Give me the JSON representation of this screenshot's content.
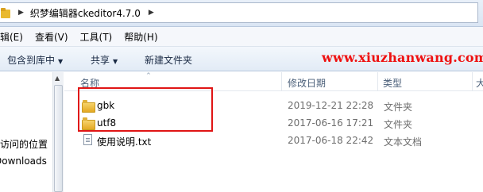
{
  "address": {
    "crumb": "织梦编辑器ckeditor4.7.0",
    "sep_glyph": "▶"
  },
  "menu": {
    "items": [
      "编辑(E)",
      "查看(V)",
      "工具(T)",
      "帮助(H)"
    ]
  },
  "toolbar": {
    "include_library": "包含到库中",
    "share": "共享",
    "new_folder": "新建文件夹",
    "dropdown_glyph": "▼"
  },
  "watermark": "www.xiuzhanwang.com",
  "nav": {
    "items": [
      "访问的位置",
      "Downloads"
    ],
    "scroll_up_glyph": "▲"
  },
  "columns": {
    "name": "名称",
    "date": "修改日期",
    "type": "类型",
    "size": "大",
    "sort_glyph": "^"
  },
  "files": [
    {
      "name": "gbk",
      "date": "2019-12-21 22:28",
      "type": "文件夹",
      "icon": "folder-icon"
    },
    {
      "name": "utf8",
      "date": "2017-06-16 17:21",
      "type": "文件夹",
      "icon": "folder-icon"
    },
    {
      "name": "使用说明.txt",
      "date": "2017-06-18 22:42",
      "type": "文本文档",
      "icon": "text-file-icon"
    }
  ],
  "colors": {
    "highlight": "#e01515",
    "watermark": "#ee1111",
    "folder": "#e9b92f"
  }
}
